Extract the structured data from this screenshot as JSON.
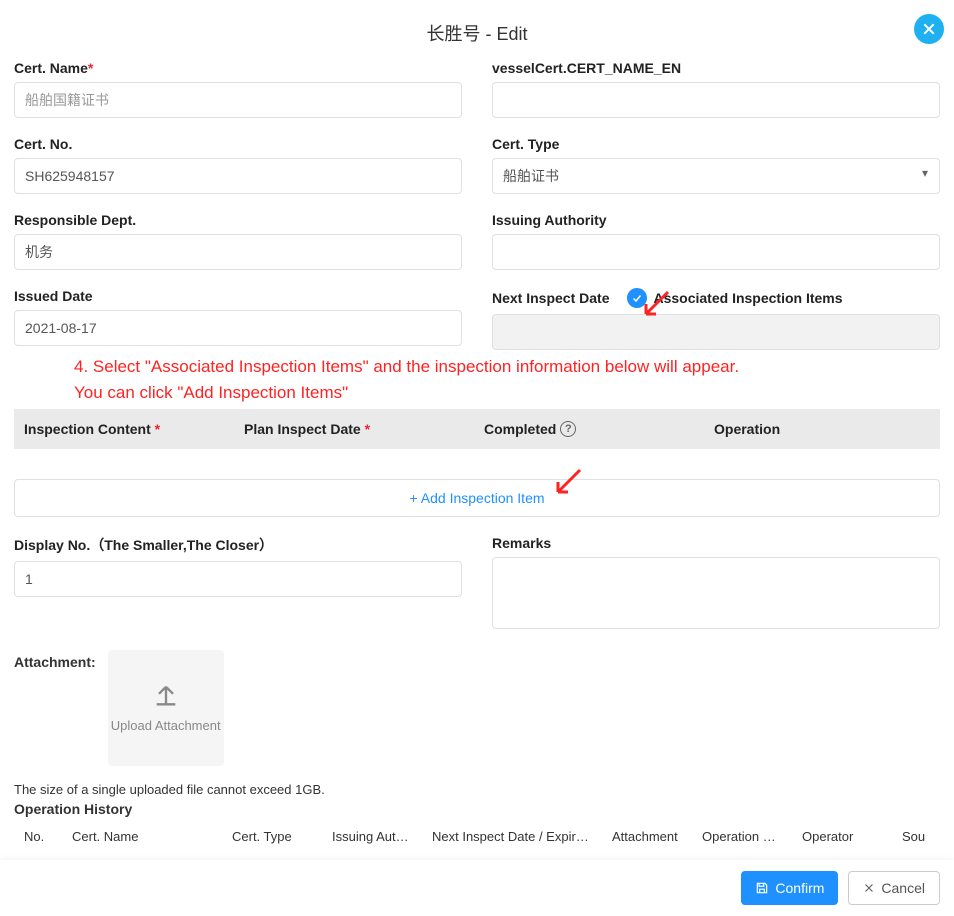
{
  "header": {
    "title": "长胜号 - Edit"
  },
  "form": {
    "cert_name": {
      "label": "Cert. Name",
      "placeholder": "船舶国籍证书",
      "value": ""
    },
    "cert_name_en": {
      "label": "vesselCert.CERT_NAME_EN",
      "value": ""
    },
    "cert_no": {
      "label": "Cert. No.",
      "value": "SH625948157"
    },
    "cert_type": {
      "label": "Cert. Type",
      "value": "船舶证书",
      "options": [
        "船舶证书"
      ]
    },
    "resp_dept": {
      "label": "Responsible Dept.",
      "value": "机务"
    },
    "issuing_auth": {
      "label": "Issuing Authority",
      "value": ""
    },
    "issued_date": {
      "label": "Issued Date",
      "value": "2021-08-17"
    },
    "next_inspect_date": {
      "label": "Next Inspect Date"
    },
    "assoc_items_label": "Associated Inspection Items",
    "display_no": {
      "label": "Display No.（The Smaller,The Closer）",
      "value": "1"
    },
    "remarks": {
      "label": "Remarks",
      "value": ""
    }
  },
  "annotation": {
    "line1": "4. Select \"Associated Inspection Items\" and the inspection information below will appear.",
    "line2": "You can click \"Add Inspection Items\""
  },
  "inspection": {
    "headers": {
      "content": "Inspection Content",
      "plan_date": "Plan Inspect Date",
      "completed": "Completed",
      "operation": "Operation"
    },
    "add_label": "+ Add Inspection Item"
  },
  "attachment": {
    "label": "Attachment:",
    "upload_label": "Upload Attachment",
    "size_hint": "The size of a single uploaded file cannot exceed 1GB."
  },
  "history": {
    "title": "Operation History",
    "cols": {
      "no": "No.",
      "cert_name": "Cert. Name",
      "cert_type": "Cert. Type",
      "issuing": "Issuing Aut…",
      "next": "Next Inspect Date / Expir…",
      "attach": "Attachment",
      "op": "Operation …",
      "operator": "Operator",
      "source": "Sou"
    }
  },
  "footer": {
    "confirm": "Confirm",
    "cancel": "Cancel"
  }
}
